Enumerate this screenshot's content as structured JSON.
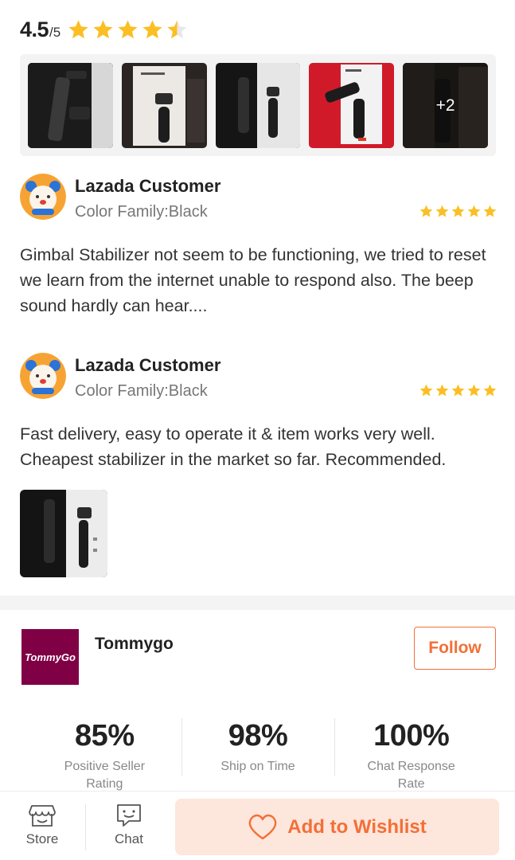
{
  "rating": {
    "score": "4.5",
    "max": "/5",
    "value": 4.5
  },
  "gallery": {
    "more_count": "+2"
  },
  "reviews": [
    {
      "name": "Lazada Customer",
      "variant": "Color Family:Black",
      "stars": 5,
      "text": "Gimbal Stabilizer not seem to be functioning, we tried to reset we learn from the internet unable to respond also. The beep sound hardly can hear...."
    },
    {
      "name": "Lazada Customer",
      "variant": "Color Family:Black",
      "stars": 5,
      "text": "Fast delivery, easy to operate it & item works very well. Cheapest stabilizer in the market so far.  Recommended."
    }
  ],
  "store": {
    "logo_text": "TommyGo",
    "name": "Tommygo",
    "follow_label": "Follow"
  },
  "stats": [
    {
      "value": "85%",
      "label": "Positive Seller Rating"
    },
    {
      "value": "98%",
      "label": "Ship on Time"
    },
    {
      "value": "100%",
      "label": "Chat Response Rate"
    }
  ],
  "bottom_bar": {
    "store_label": "Store",
    "chat_label": "Chat",
    "wishlist_label": "Add to Wishlist"
  },
  "colors": {
    "accent": "#f36f37",
    "star": "#fbbf24",
    "wishlist_bg": "#fde6dc",
    "store_logo_bg": "#800046"
  },
  "icons": {
    "star": "star-icon",
    "store": "store-icon",
    "chat": "chat-icon",
    "wishlist": "heart-icon"
  }
}
